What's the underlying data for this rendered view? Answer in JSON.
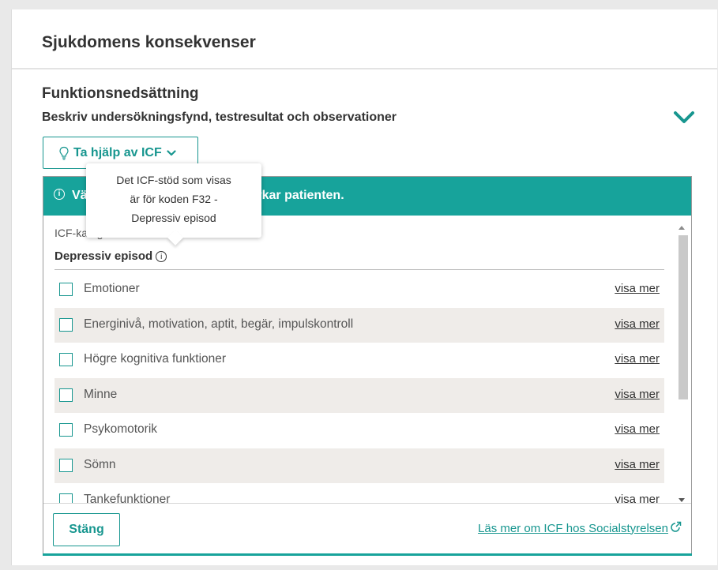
{
  "colors": {
    "accent": "#17a39b",
    "accent_dark": "#17968f",
    "row_alt": "#efece9"
  },
  "section": {
    "title": "Sjukdomens konsekvenser",
    "subtitle": "Funktionsnedsättning",
    "description": "Beskriv undersökningsfynd, testresultat och observationer",
    "toggle_icon": "chevron-down-icon"
  },
  "icf_button": {
    "label": "Ta hjälp av ICF",
    "icon": "lightbulb-icon",
    "chevron": "chevron-down-icon"
  },
  "tooltip": {
    "lines": [
      "Det ICF-stöd som visas",
      "är för koden F32 -",
      "Depressiv episod"
    ]
  },
  "banner": {
    "info": "i",
    "text_start": "Vä",
    "text_end": "verkar patienten."
  },
  "categories": {
    "label": "ICF-kategorier för:",
    "name": "Depressiv episod",
    "info": "i",
    "link_label": "visa mer",
    "items": [
      {
        "label": "Emotioner",
        "link": "visa mer"
      },
      {
        "label": "Energinivå, motivation, aptit, begär, impulskontroll",
        "link": "visa mer"
      },
      {
        "label": "Högre kognitiva funktioner",
        "link": "visa mer"
      },
      {
        "label": "Minne",
        "link": "visa mer"
      },
      {
        "label": "Psykomotorik",
        "link": "visa mer"
      },
      {
        "label": "Sömn",
        "link": "visa mer"
      },
      {
        "label": "Tankefunktioner",
        "link": "visa mer"
      }
    ]
  },
  "footer": {
    "close_label": "Stäng",
    "external_link": "Läs mer om ICF hos Socialstyrelsen",
    "external_icon": "external-link-icon"
  }
}
